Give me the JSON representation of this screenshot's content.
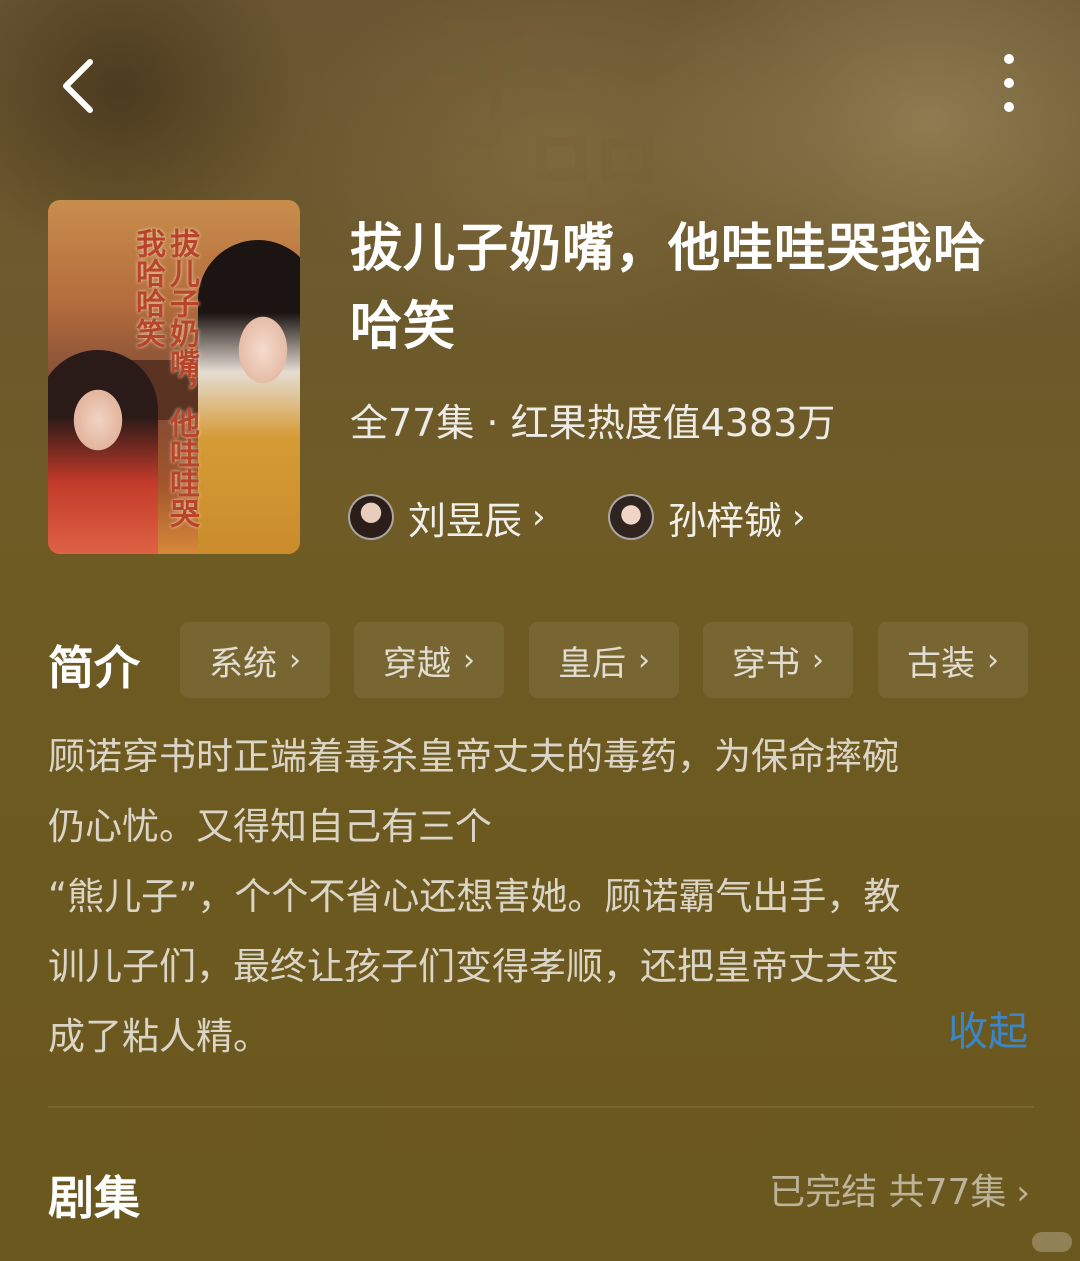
{
  "header": {
    "back_icon": "chevron-left-icon",
    "more_icon": "more-vertical-icon"
  },
  "drama": {
    "title": "拔儿子奶嘴，他哇哇哭我哈哈笑",
    "meta": "全77集 · 红果热度值4383万",
    "cast": [
      {
        "name": "刘昱辰",
        "avatar_color": "#3a2a26"
      },
      {
        "name": "孙梓铖",
        "avatar_color": "#4a3a30"
      }
    ]
  },
  "intro": {
    "heading": "简介",
    "tags": [
      "系统",
      "穿越",
      "皇后",
      "穿书",
      "古装"
    ],
    "description": "顾诺穿书时正端着毒杀皇帝丈夫的毒药，为保命摔碗\n仍心忧。又得知自己有三个\n“熊儿子”，个个不省心还想害她。顾诺霸气出手，教\n训儿子们，最终让孩子们变得孝顺，还把皇帝丈夫变\n成了粘人精。",
    "collapse_label": "收起"
  },
  "episodes": {
    "heading": "剧集",
    "status": "已完结 共77集"
  },
  "colors": {
    "background": "#6d5a21",
    "link": "#3c86c8"
  }
}
